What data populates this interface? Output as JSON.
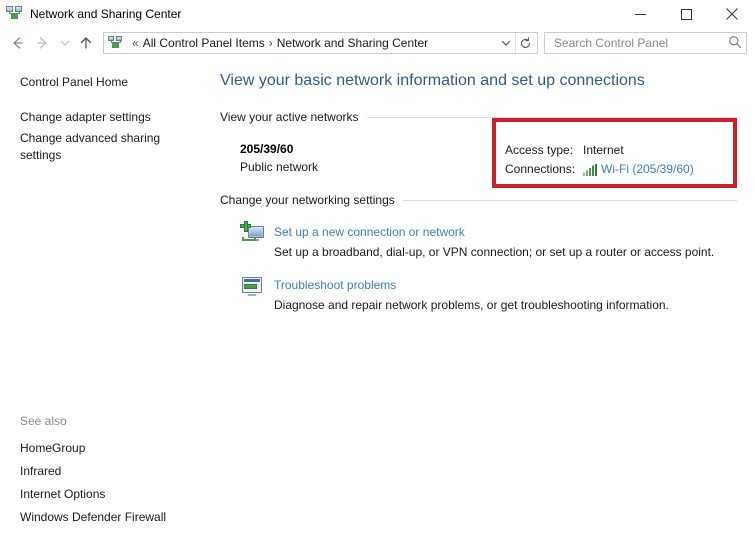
{
  "window": {
    "title": "Network and Sharing Center",
    "icon": "network-sharing-icon",
    "minimize_label": "Minimize",
    "maximize_label": "Maximize",
    "close_label": "Close"
  },
  "navbar": {
    "back_label": "Back",
    "forward_label": "Forward",
    "recent_label": "Recent locations",
    "up_label": "Up",
    "breadcrumb_icon": "network-sharing-icon",
    "breadcrumb_prefix": "«",
    "crumb1": "All Control Panel Items",
    "crumb_separator": "›",
    "crumb2": "Network and Sharing Center",
    "dropdown_icon": "chevron-down-icon",
    "refresh_icon": "refresh-icon"
  },
  "search": {
    "placeholder": "Search Control Panel",
    "value": "",
    "icon": "search-icon"
  },
  "sidebar": {
    "items": [
      {
        "label": "Control Panel Home"
      },
      {
        "label": "Change adapter settings"
      },
      {
        "label": "Change advanced sharing settings"
      }
    ],
    "see_also": {
      "title": "See also",
      "items": [
        {
          "label": "HomeGroup"
        },
        {
          "label": "Infrared"
        },
        {
          "label": "Internet Options"
        },
        {
          "label": "Windows Defender Firewall"
        }
      ]
    }
  },
  "main": {
    "heading": "View your basic network information and set up connections",
    "active_networks": {
      "section_title": "View your active networks",
      "network_name": "205/39/60",
      "network_type": "Public network",
      "access_type_label": "Access type:",
      "access_type_value": "Internet",
      "connections_label": "Connections:",
      "connections_icon": "wifi-signal-icon",
      "connections_value": "Wi-Fi (205/39/60)"
    },
    "networking_settings": {
      "section_title": "Change your networking settings",
      "tasks": [
        {
          "icon": "new-connection-icon",
          "title": "Set up a new connection or network",
          "description": "Set up a broadband, dial-up, or VPN connection; or set up a router or access point."
        },
        {
          "icon": "troubleshoot-icon",
          "title": "Troubleshoot problems",
          "description": "Diagnose and repair network problems, or get troubleshooting information."
        }
      ]
    }
  },
  "annotation": {
    "highlight_color": "#cc2229"
  },
  "colors": {
    "link": "#3f7fb3",
    "heading": "#2f5c86",
    "signal_green": "#4a9a52"
  }
}
